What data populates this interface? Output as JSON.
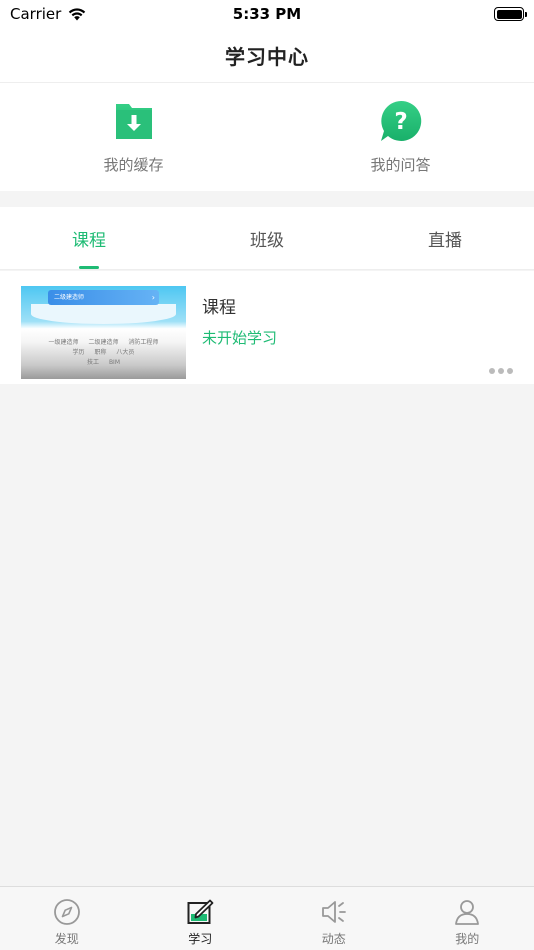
{
  "status_bar": {
    "carrier": "Carrier",
    "time": "5:33 PM"
  },
  "nav": {
    "title": "学习中心"
  },
  "quick": {
    "cache_label": "我的缓存",
    "qa_label": "我的问答"
  },
  "tabs": [
    {
      "label": "课程"
    },
    {
      "label": "班级"
    },
    {
      "label": "直播"
    }
  ],
  "course": {
    "title": "课程",
    "status": "未开始学习",
    "thumb_banner": "二级建造师",
    "thumb_tags_row1": [
      "一级建造师",
      "二级建造师",
      "消防工程师"
    ],
    "thumb_tags_row2": [
      "学历",
      "职称",
      "八大员"
    ],
    "thumb_tags_row3": [
      "技工",
      "BIM"
    ]
  },
  "tab_bar": [
    {
      "label": "发现",
      "icon": "compass-icon"
    },
    {
      "label": "学习",
      "icon": "study-icon"
    },
    {
      "label": "动态",
      "icon": "speaker-icon"
    },
    {
      "label": "我的",
      "icon": "person-icon"
    }
  ],
  "colors": {
    "accent": "#1ebb74"
  }
}
